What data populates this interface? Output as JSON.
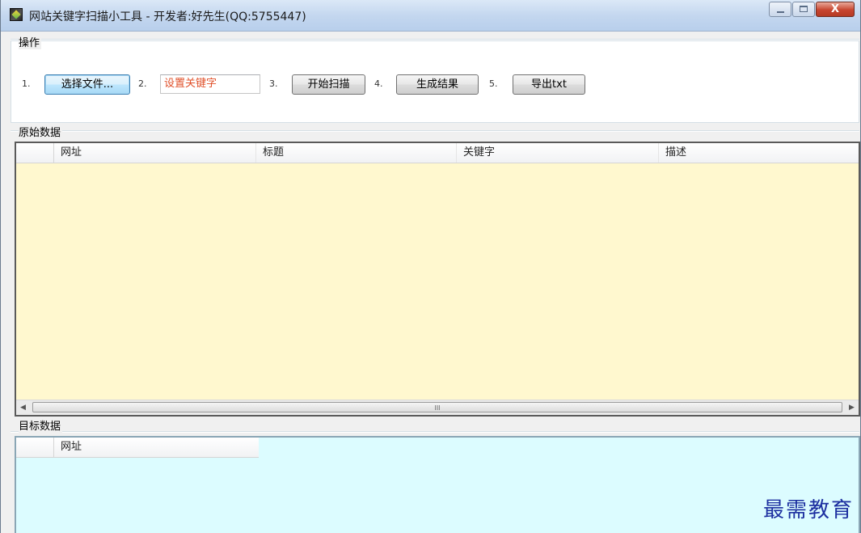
{
  "window": {
    "title": "网站关键字扫描小工具 - 开发者:好先生(QQ:5755447)",
    "close_glyph": "X"
  },
  "operations": {
    "group_label": "操作",
    "steps": [
      {
        "num": "1.",
        "label": "选择文件..."
      },
      {
        "num": "2.",
        "input_value": "设置关键字"
      },
      {
        "num": "3.",
        "label": "开始扫描"
      },
      {
        "num": "4.",
        "label": "生成结果"
      },
      {
        "num": "5.",
        "label": "导出txt"
      }
    ]
  },
  "source_grid": {
    "group_label": "原始数据",
    "columns": [
      "网址",
      "标题",
      "关键字",
      "描述"
    ],
    "rows": [],
    "background": "#fff8cf",
    "scroll_grip": "III"
  },
  "target_grid": {
    "group_label": "目标数据",
    "columns": [
      "网址"
    ],
    "rows": [],
    "background": "#dcfcff"
  },
  "watermark": "最需教育",
  "colors": {
    "input_text": "#e0502a",
    "source_bg": "#fff8cf",
    "target_bg": "#dcfcff",
    "watermark": "#1c2fa0"
  }
}
